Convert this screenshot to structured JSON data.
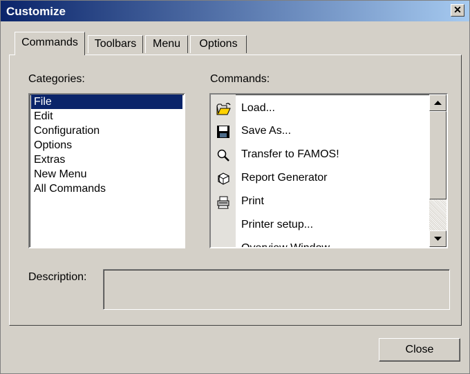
{
  "window": {
    "title": "Customize",
    "close_glyph": "✕"
  },
  "tabs": [
    {
      "label": "Commands",
      "active": true
    },
    {
      "label": "Toolbars",
      "active": false
    },
    {
      "label": "Menu",
      "active": false
    },
    {
      "label": "Options",
      "active": false
    }
  ],
  "categories": {
    "label": "Categories:",
    "items": [
      "File",
      "Edit",
      "Configuration",
      "Options",
      "Extras",
      "New Menu",
      "All Commands"
    ],
    "selected": "File"
  },
  "commands": {
    "label": "Commands:",
    "items": [
      {
        "label": "Load...",
        "icon": "open-folder-icon"
      },
      {
        "label": "Save As...",
        "icon": "floppy-disk-icon"
      },
      {
        "label": "Transfer to FAMOS!",
        "icon": "magnifier-icon"
      },
      {
        "label": "Report Generator",
        "icon": "report-icon"
      },
      {
        "label": "Print",
        "icon": "printer-icon"
      },
      {
        "label": "Printer setup...",
        "icon": ""
      },
      {
        "label": "Overview Window",
        "icon": ""
      }
    ]
  },
  "description": {
    "label": "Description:",
    "value": ""
  },
  "footer": {
    "close_label": "Close"
  },
  "colors": {
    "titlebar": "#0a246a",
    "selection": "#0a246a",
    "face": "#d4d0c8"
  }
}
